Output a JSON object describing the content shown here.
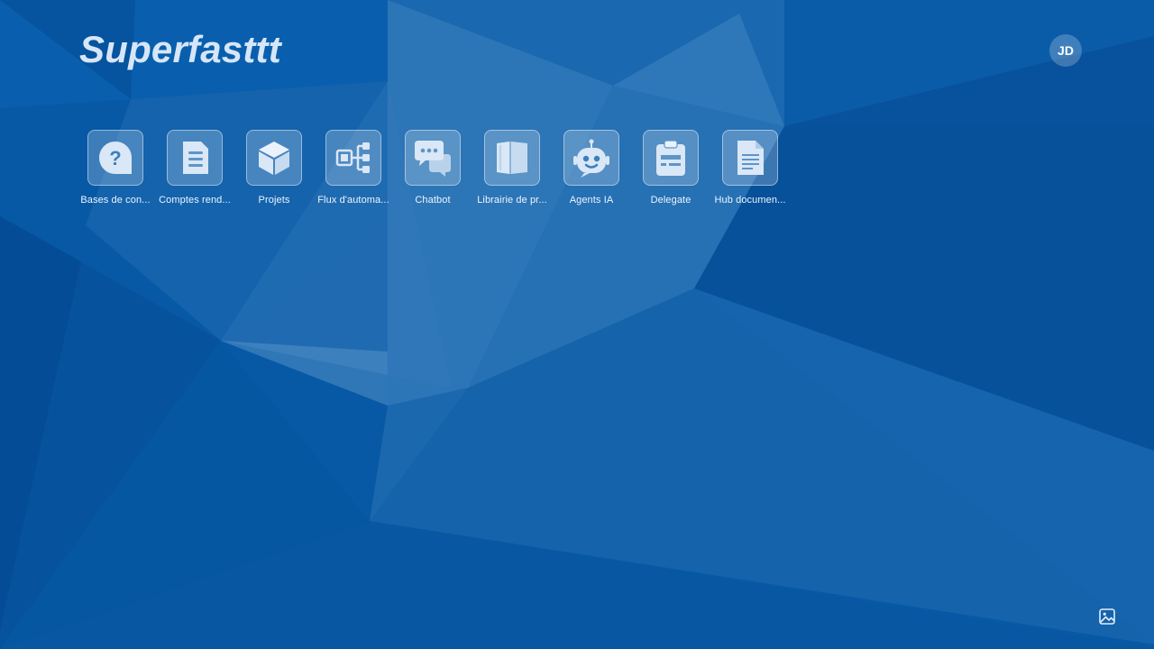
{
  "brand": {
    "title": "Superfasttt"
  },
  "user": {
    "initials": "JD"
  },
  "apps": [
    {
      "label": "Bases de con...",
      "icon": "question-bubble-icon"
    },
    {
      "label": "Comptes rend...",
      "icon": "document-lines-icon"
    },
    {
      "label": "Projets",
      "icon": "cube-icon"
    },
    {
      "label": "Flux d'automa...",
      "icon": "workflow-icon"
    },
    {
      "label": "Chatbot",
      "icon": "chat-bubbles-icon"
    },
    {
      "label": "Librairie de pr...",
      "icon": "book-icon"
    },
    {
      "label": "Agents IA",
      "icon": "robot-icon"
    },
    {
      "label": "Delegate",
      "icon": "clipboard-icon"
    },
    {
      "label": "Hub documen...",
      "icon": "file-text-icon"
    }
  ],
  "footer": {
    "wallpaper_icon": "image-icon"
  },
  "colors": {
    "background": "#0759a6",
    "tile_fill": "rgba(255,255,255,0.22)",
    "icon": "#d9e7f6",
    "brand_text": "#d6e6f8"
  }
}
